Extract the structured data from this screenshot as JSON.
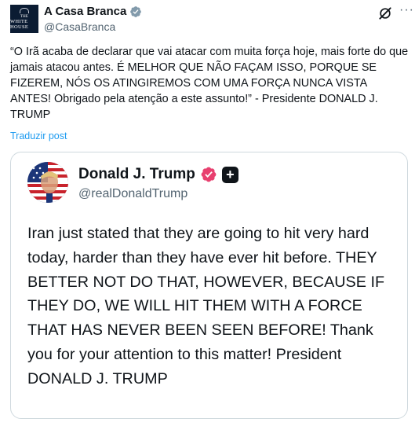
{
  "tweet": {
    "avatar_text": [
      "THE",
      "WHITE HOUSE"
    ],
    "author_name": "A Casa Branca",
    "author_handle": "@CasaBranca",
    "verification_badge": "gray-verified",
    "body": "“O Irã acaba de declarar que vai atacar com muita força hoje, mais forte do que jamais atacou antes. É MELHOR QUE NÃO FAÇAM ISSO, PORQUE SE FIZEREM, NÓS OS ATINGIREMOS COM UMA FORÇA NUNCA VISTA ANTES! Obrigado pela atenção a este assunto!” - Presidente DONALD J. TRUMP",
    "translate_label": "Traduzir post",
    "more_label": "···"
  },
  "quoted": {
    "author_name": "Donald J. Trump",
    "author_handle": "@realDonaldTrump",
    "plus_label": "+",
    "body": "Iran just stated that they are going to hit very hard today, harder than they have ever hit before. THEY BETTER NOT DO THAT, HOWEVER, BECAUSE IF THEY DO, WE WILL HIT THEM WITH A FORCE THAT HAS NEVER BEEN SEEN BEFORE! Thank you for your attention to this matter! President DONALD J. TRUMP"
  },
  "colors": {
    "text": "#0f1419",
    "secondary": "#536471",
    "link": "#1d9bf0",
    "border": "#cfd9de",
    "truth_badge": "#e8406f",
    "gov_badge": "#829aab"
  }
}
